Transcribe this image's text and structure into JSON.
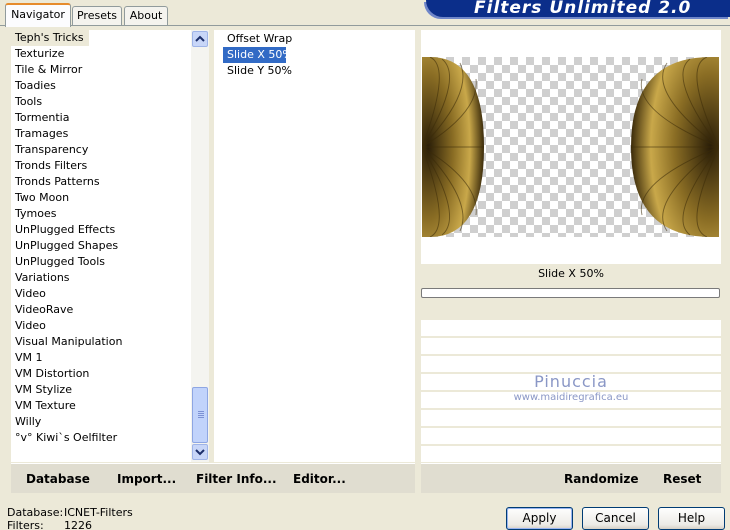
{
  "tabs": [
    "Navigator",
    "Presets",
    "About"
  ],
  "banner": "Filters Unlimited 2.0",
  "categories": [
    "Teph's Tricks",
    "Texturize",
    "Tile & Mirror",
    "Toadies",
    "Tools",
    "Tormentia",
    "Tramages",
    "Transparency",
    "Tronds Filters",
    "Tronds Patterns",
    "Two Moon",
    "Tymoes",
    "UnPlugged Effects",
    "UnPlugged Shapes",
    "UnPlugged Tools",
    "Variations",
    "Video",
    "VideoRave",
    "Video",
    "Visual Manipulation",
    "VM 1",
    "VM Distortion",
    "VM Stylize",
    "VM Texture",
    "Willy",
    "°v° Kiwi`s Oelfilter"
  ],
  "filters": [
    "Offset Wrap",
    "Slide X 50%",
    "Slide Y 50%"
  ],
  "preview": {
    "filter_name": "Slide X 50%",
    "watermark_title": "Pinuccia",
    "watermark_url": "www.maidiregrafica.eu"
  },
  "left_bar": {
    "database": "Database",
    "import": "Import...",
    "filter_info": "Filter Info...",
    "editor": "Editor..."
  },
  "right_bar": {
    "randomize": "Randomize",
    "reset": "Reset"
  },
  "status": {
    "database_label": "Database:",
    "database_value": "ICNET-Filters",
    "filters_label": "Filters:",
    "filters_value": "1226"
  },
  "buttons": {
    "apply": "Apply",
    "cancel": "Cancel",
    "help": "Help"
  },
  "colors": {
    "selection": "#316ac5",
    "banner": "#0b2e8a",
    "watermark": "#8a97c6"
  }
}
